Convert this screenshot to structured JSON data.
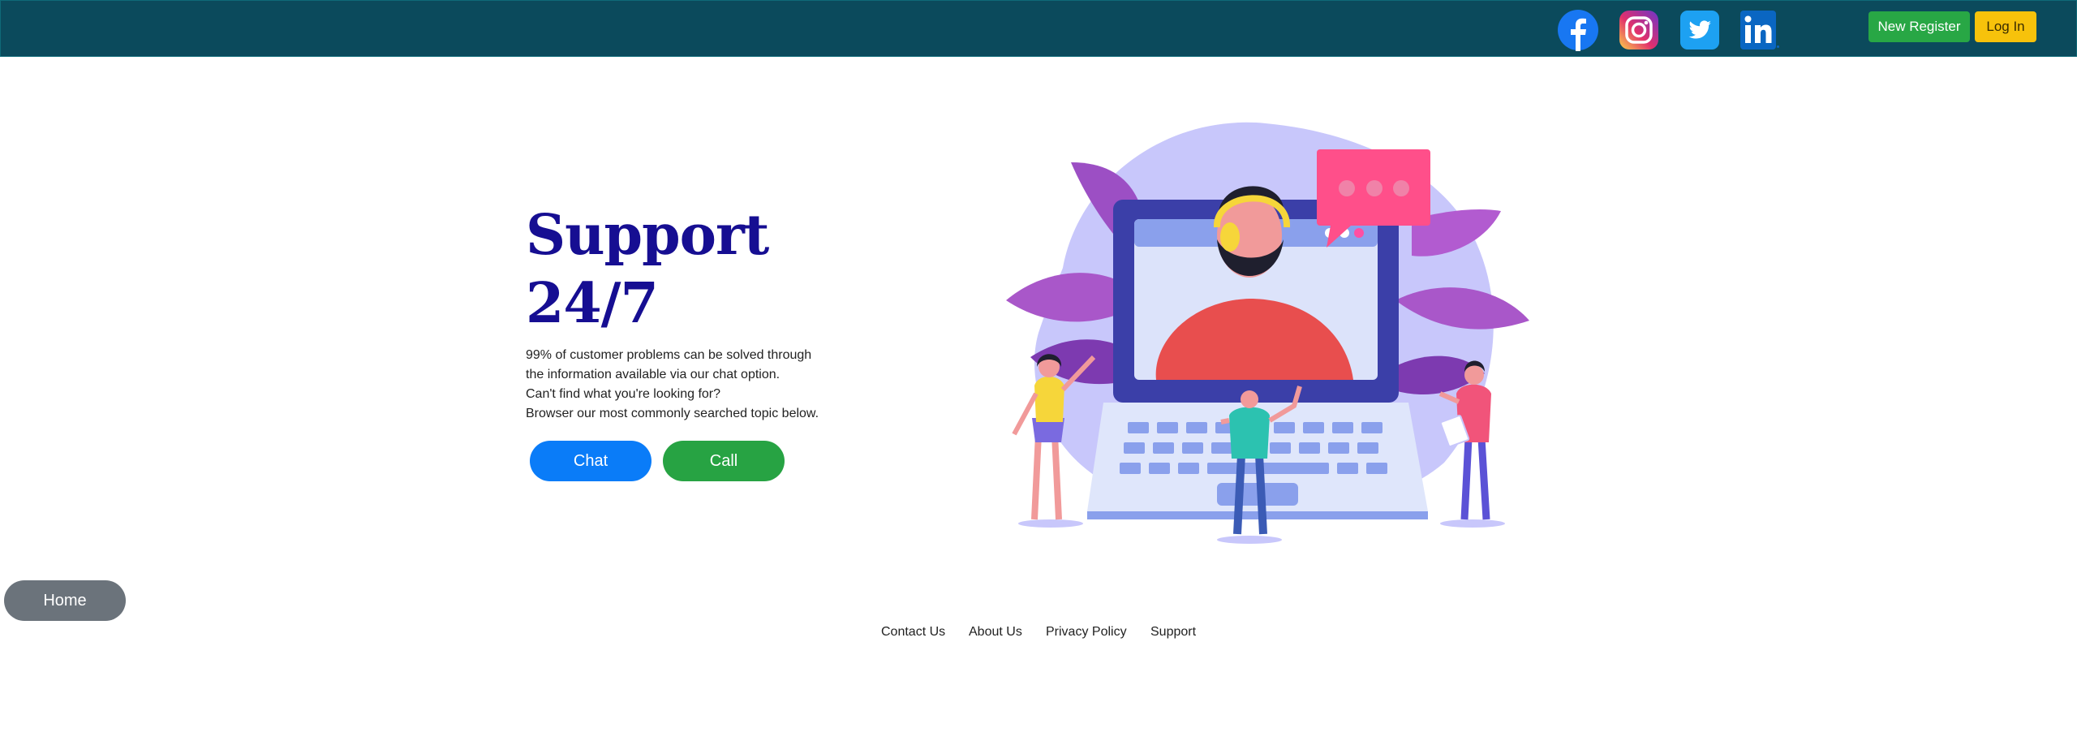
{
  "navbar": {
    "social": [
      {
        "icon": "facebook-icon",
        "color": "#1877f2"
      },
      {
        "icon": "instagram-icon",
        "color": "#d6249f"
      },
      {
        "icon": "twitter-icon",
        "color": "#1da1f2"
      },
      {
        "icon": "linkedin-icon",
        "color": "#0a66c2"
      }
    ],
    "new_register_label": "New Register",
    "login_label": "Log In",
    "background": "#0b4a5c"
  },
  "hero": {
    "title_line1": "Support",
    "title_line2": "24/7",
    "text_lines": [
      "99% of customer problems can be solved through",
      "the information available via our chat option.",
      "Can't find what you're looking for?",
      "Browser our most commonly searched topic below."
    ],
    "chat_label": "Chat",
    "call_label": "Call"
  },
  "home_label": "Home",
  "footer": {
    "links": [
      "Contact Us",
      "About Us",
      "Privacy Policy",
      "Support"
    ]
  },
  "colors": {
    "title": "#160e92",
    "chat": "#0a7cf8",
    "call": "#27a343",
    "register": "#28a745",
    "login": "#f7c20b",
    "home": "#6b737b"
  }
}
